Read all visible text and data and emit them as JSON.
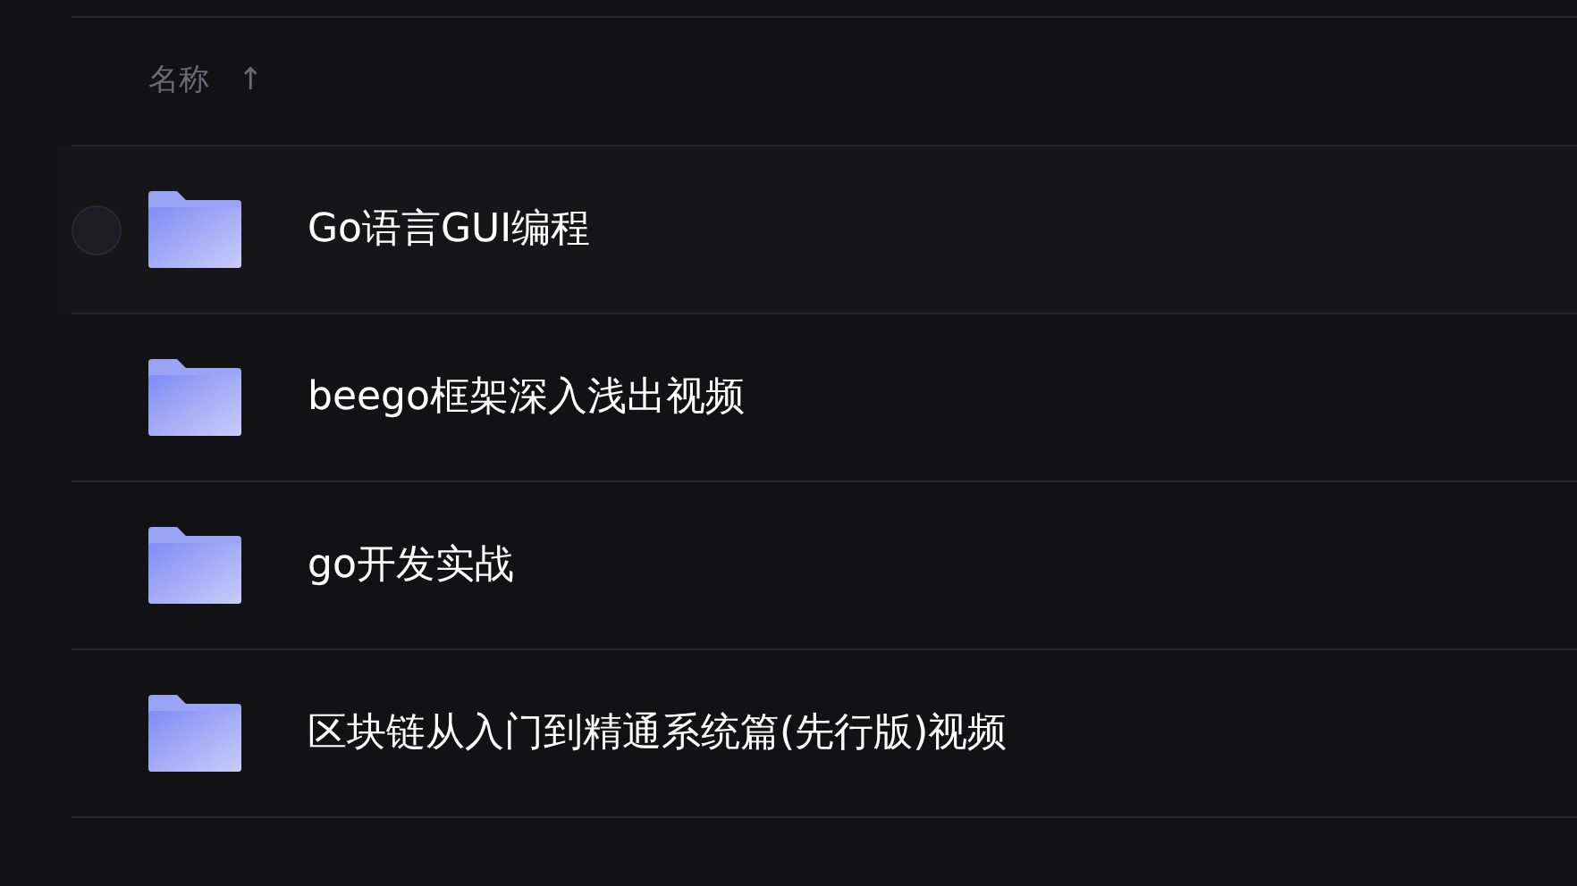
{
  "header": {
    "label": "名称",
    "sort_icon": "↑"
  },
  "files": [
    {
      "name": "Go语言GUI编程",
      "hovered": true
    },
    {
      "name": "beego框架深入浅出视频",
      "hovered": false
    },
    {
      "name": "go开发实战",
      "hovered": false
    },
    {
      "name": "区块链从入门到精通系统篇(先行版)视频",
      "hovered": false
    }
  ]
}
